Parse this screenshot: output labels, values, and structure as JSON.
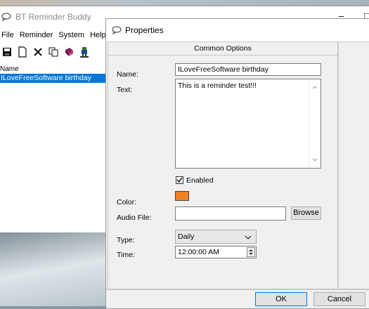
{
  "main_window": {
    "title": "BT Reminder Buddy",
    "menu": [
      "File",
      "Reminder",
      "System",
      "Help"
    ],
    "list_header": "Name",
    "list_items": [
      "ILoveFreeSoftware birthday"
    ],
    "minimize_glyph": "–",
    "maximize_glyph": "□"
  },
  "dialog": {
    "title": "Properties",
    "group_title": "Common Options",
    "name_label": "Name:",
    "name_value": "ILoveFreeSoftware birthday",
    "text_label": "Text:",
    "text_value": "This is a reminder test!!!",
    "enabled_label": "Enabled",
    "enabled_checked": true,
    "color_label": "Color:",
    "color_value": "#f08020",
    "audio_label": "Audio File:",
    "audio_value": "",
    "browse_label": "Browse",
    "type_label": "Type:",
    "type_value": "Daily",
    "time_label": "Time:",
    "time_value": "12:00:00 AM",
    "ok_label": "OK",
    "cancel_label": "Cancel"
  }
}
